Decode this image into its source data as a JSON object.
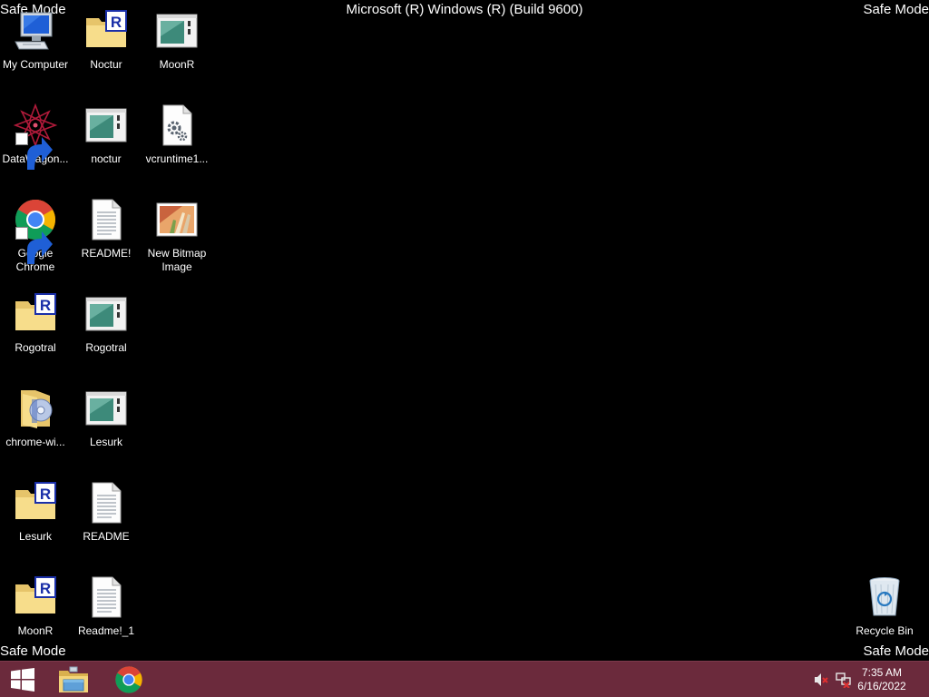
{
  "banners": {
    "top_left": "Safe Mode",
    "top_right": "Safe Mode",
    "bottom_left": "Safe Mode",
    "bottom_right": "Safe Mode",
    "title": "Microsoft (R) Windows (R) (Build 9600)"
  },
  "desktop": {
    "icons": [
      {
        "label": "My Computer",
        "icon": "computer-icon"
      },
      {
        "label": "Noctur",
        "icon": "r-folder-icon"
      },
      {
        "label": "MoonR",
        "icon": "app-window-icon"
      },
      {
        "label": "DataWagon...",
        "icon": "datawagon-icon",
        "shortcut": true
      },
      {
        "label": "noctur",
        "icon": "app-window-icon"
      },
      {
        "label": "vcruntime1...",
        "icon": "dll-file-icon"
      },
      {
        "label": "Google Chrome",
        "icon": "chrome-icon",
        "shortcut": true
      },
      {
        "label": "README!",
        "icon": "text-file-icon"
      },
      {
        "label": "New Bitmap Image",
        "icon": "bitmap-icon"
      },
      {
        "label": "Rogotral",
        "icon": "r-folder-icon"
      },
      {
        "label": "Rogotral",
        "icon": "app-window-icon"
      },
      {
        "label": "chrome-wi...",
        "icon": "chrome-folder-icon"
      },
      {
        "label": "Lesurk",
        "icon": "app-window-icon"
      },
      {
        "label": "Lesurk",
        "icon": "r-folder-icon"
      },
      {
        "label": "README",
        "icon": "text-file-icon"
      },
      {
        "label": "MoonR",
        "icon": "r-folder-icon"
      },
      {
        "label": "Readme!_1",
        "icon": "text-file-icon"
      },
      {
        "label": "Recycle Bin",
        "icon": "recycle-bin-icon"
      }
    ]
  },
  "taskbar": {
    "start_icon": "windows-logo-icon",
    "pinned": [
      {
        "name": "File Explorer",
        "icon": "file-explorer-icon"
      },
      {
        "name": "Google Chrome",
        "icon": "chrome-icon"
      }
    ],
    "tray": [
      {
        "icon": "speaker-muted-icon"
      },
      {
        "icon": "network-disconnected-icon"
      }
    ],
    "clock": {
      "time": "7:35 AM",
      "date": "6/16/2022"
    }
  }
}
